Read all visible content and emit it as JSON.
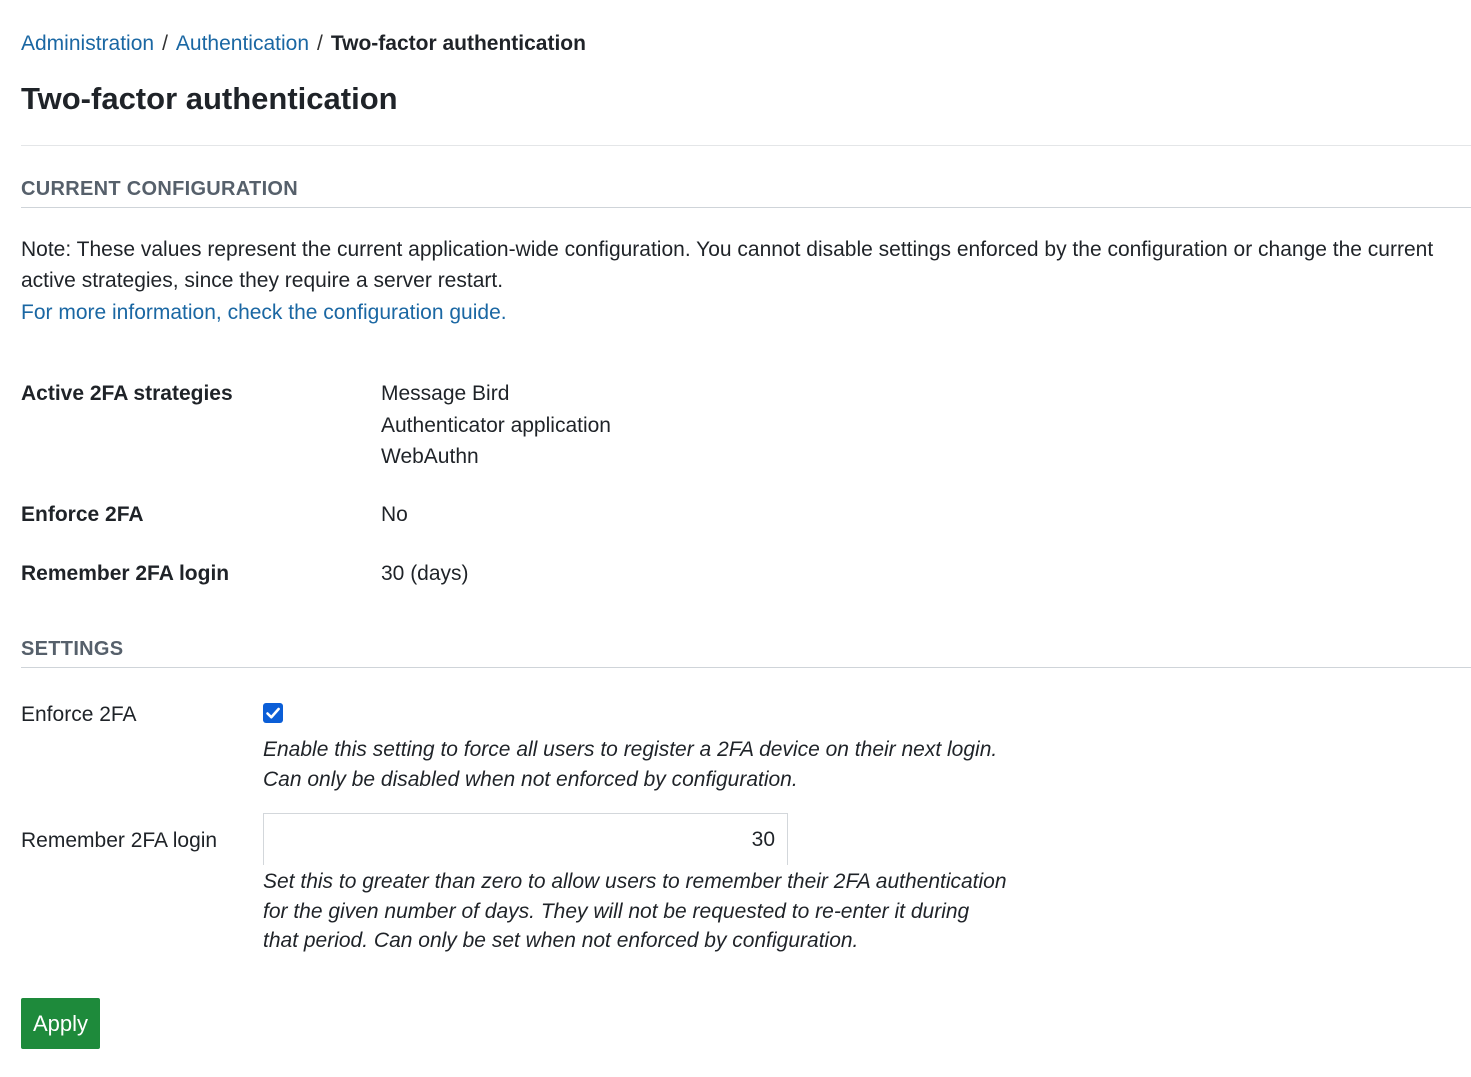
{
  "breadcrumb": {
    "items": [
      "Administration",
      "Authentication"
    ],
    "separator": "/",
    "current": "Two-factor authentication"
  },
  "page_title": "Two-factor authentication",
  "current_configuration": {
    "header": "CURRENT CONFIGURATION",
    "note": "Note: These values represent the current application-wide configuration. You cannot disable settings enforced by the configuration or change the current active strategies, since they require a server restart.",
    "link_text": "For more information, check the configuration guide.",
    "attributes": {
      "active_strategies_label": "Active 2FA strategies",
      "active_strategies": [
        "Message Bird",
        "Authenticator application",
        "WebAuthn"
      ],
      "enforce_label": "Enforce 2FA",
      "enforce_value": "No",
      "remember_label": "Remember 2FA login",
      "remember_value": "30 (days)"
    }
  },
  "settings": {
    "header": "SETTINGS",
    "enforce_label": "Enforce 2FA",
    "enforce_checked": true,
    "enforce_help_line1": "Enable this setting to force all users to register a 2FA device on their next login.",
    "enforce_help_line2": "Can only be disabled when not enforced by configuration.",
    "remember_label": "Remember 2FA login",
    "remember_value": "30",
    "remember_help": "Set this to greater than zero to allow users to remember their 2FA authentication for the given number of days. They will not be requested to re-enter it during that period. Can only be set when not enforced by configuration."
  },
  "apply_label": "Apply",
  "colors": {
    "link": "#1a67a3",
    "checkbox": "#0b5ed7",
    "apply_button": "#1e8a3b",
    "section_header": "#56606b"
  }
}
